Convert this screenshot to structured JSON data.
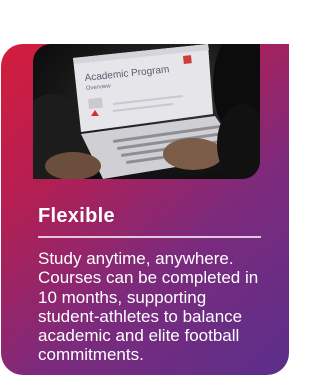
{
  "card": {
    "title": "Flexible",
    "body": "Study anytime, anywhere. Courses can be completed in 10 months, supporting student-athletes to balance academic and elite football commitments.",
    "gradient_colors": [
      "#d41d3c",
      "#7d2a7c",
      "#5a2f8a"
    ]
  },
  "photo": {
    "screen_title": "Academic Program",
    "screen_subtitle": "Overview"
  }
}
